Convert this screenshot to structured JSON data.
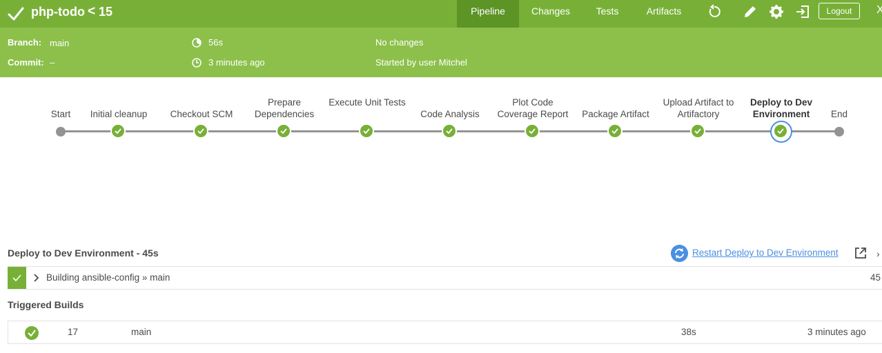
{
  "header": {
    "title": "php-todo",
    "run_separator": "<",
    "run_number": "15",
    "tabs": [
      "Pipeline",
      "Changes",
      "Tests",
      "Artifacts"
    ],
    "active_tab": "Pipeline",
    "logout_label": "Logout",
    "more_glyph": "X",
    "icons": [
      "check-icon",
      "replay-icon",
      "edit-icon",
      "settings-icon",
      "exit-icon"
    ]
  },
  "info": {
    "branch_label": "Branch:",
    "branch_value": "main",
    "commit_label": "Commit:",
    "commit_value": "–",
    "duration": "56s",
    "started_ago": "3 minutes ago",
    "changes": "No changes",
    "started_by": "Started by user Mitchel"
  },
  "pipeline": {
    "stages": [
      {
        "label": "Start",
        "status": "start"
      },
      {
        "label": "Initial cleanup",
        "status": "success"
      },
      {
        "label": "Checkout SCM",
        "status": "success"
      },
      {
        "label": "Prepare Dependencies",
        "status": "success"
      },
      {
        "label": "Execute Unit Tests",
        "status": "success"
      },
      {
        "label": "Code Analysis",
        "status": "success"
      },
      {
        "label": "Plot Code Coverage Report",
        "status": "success"
      },
      {
        "label": "Package Artifact",
        "status": "success"
      },
      {
        "label": "Upload Artifact to Artifactory",
        "status": "success"
      },
      {
        "label": "Deploy to Dev Environment",
        "status": "success",
        "selected": true
      },
      {
        "label": "End",
        "status": "end"
      }
    ]
  },
  "step_detail": {
    "title": "Deploy to Dev Environment - 45s",
    "restart_label": "Restart Deploy to Dev Environment",
    "more_glyph": "›",
    "steps": [
      {
        "text": "Building ansible-config » main",
        "duration": "45"
      }
    ]
  },
  "triggered": {
    "title": "Triggered Builds",
    "builds": [
      {
        "number": "17",
        "branch": "main",
        "duration": "38s",
        "when": "3 minutes ago"
      }
    ]
  },
  "colors": {
    "header_green": "#78b037",
    "info_green": "#8cc04b",
    "active_tab": "#5c9426",
    "success": "#78b037",
    "link_blue": "#4a90e2",
    "line_grey": "#949393"
  }
}
